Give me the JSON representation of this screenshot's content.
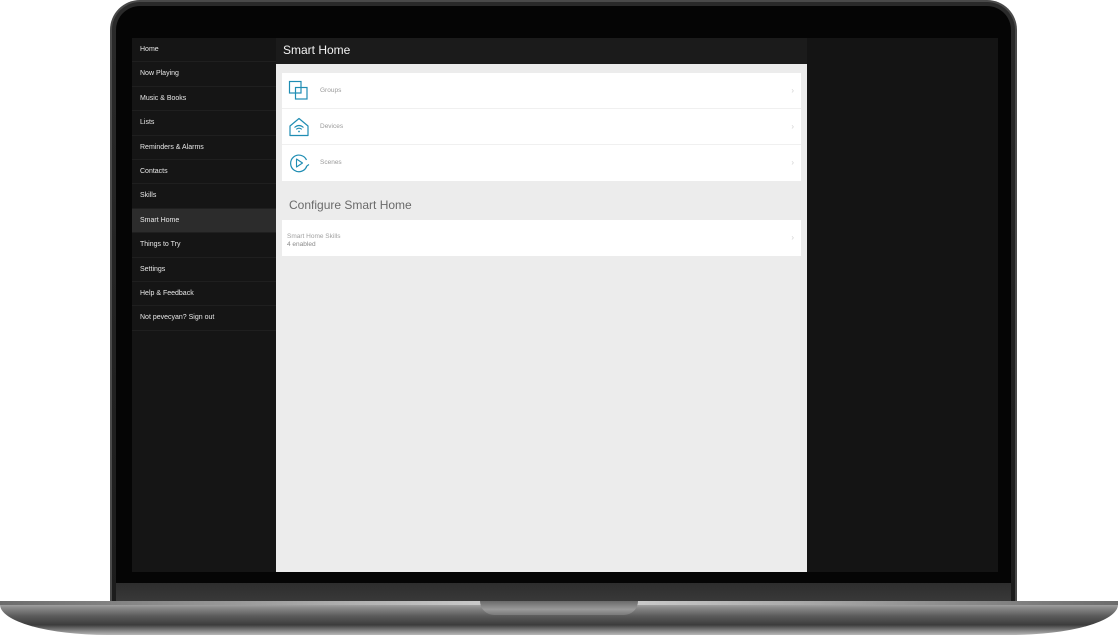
{
  "sidebar": {
    "items": [
      {
        "label": "Home"
      },
      {
        "label": "Now Playing"
      },
      {
        "label": "Music & Books"
      },
      {
        "label": "Lists"
      },
      {
        "label": "Reminders & Alarms"
      },
      {
        "label": "Contacts"
      },
      {
        "label": "Skills"
      },
      {
        "label": "Smart Home"
      },
      {
        "label": "Things to Try"
      },
      {
        "label": "Settings"
      },
      {
        "label": "Help & Feedback"
      },
      {
        "label": "Not pevecyan? Sign out"
      }
    ],
    "active_label": "Smart Home"
  },
  "header": {
    "title": "Smart Home"
  },
  "rows": [
    {
      "label": "Groups",
      "icon": "groups-icon"
    },
    {
      "label": "Devices",
      "icon": "devices-icon"
    },
    {
      "label": "Scenes",
      "icon": "scenes-icon"
    }
  ],
  "configure": {
    "title": "Configure Smart Home",
    "skills_title": "Smart Home Skills",
    "skills_subtitle": "4 enabled"
  },
  "colors": {
    "accent": "#1f8db3",
    "sidebar_bg": "#151515",
    "content_bg": "#ececec"
  }
}
